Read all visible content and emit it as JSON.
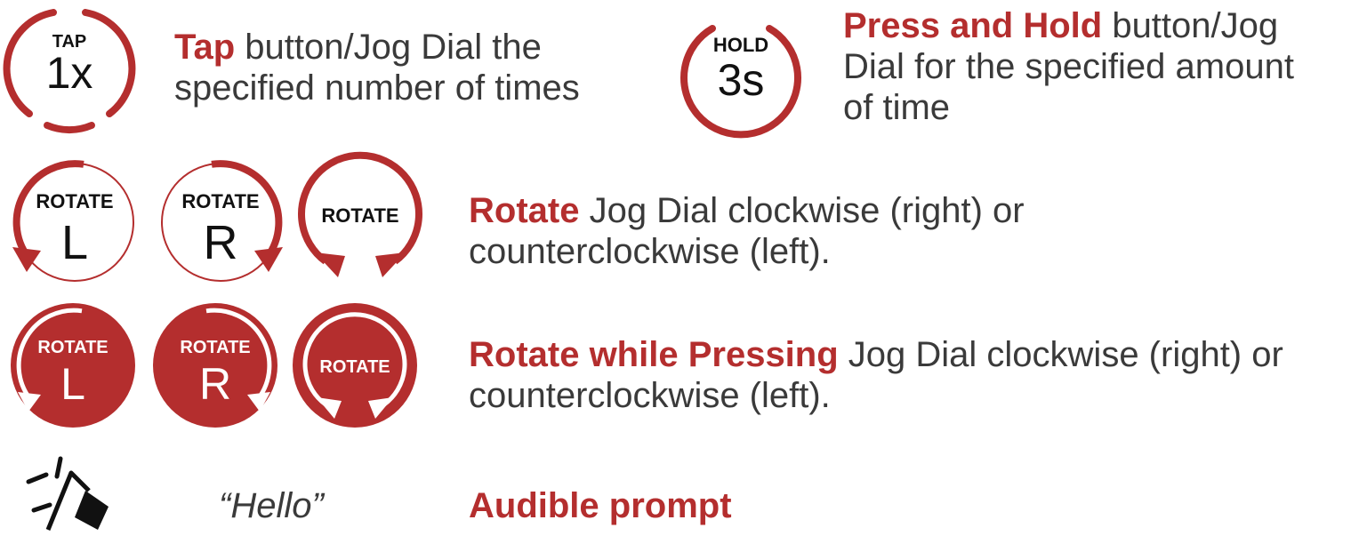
{
  "colors": {
    "accent": "#b42e2e",
    "text": "#3a3a3a",
    "background": "#ffffff"
  },
  "tap": {
    "icon": {
      "top": "TAP",
      "main": "1x"
    },
    "highlight": "Tap",
    "line1_rest": " button/Jog Dial the",
    "line2": "specified number of times"
  },
  "hold": {
    "icon": {
      "top": "HOLD",
      "main": "3s"
    },
    "highlight": "Press and Hold",
    "line1_rest": " button/Jog",
    "line2": "Dial for the specified amount",
    "line3": "of time"
  },
  "rotate": {
    "icons": {
      "left_top": "ROTATE",
      "left_main": "L",
      "right_top": "ROTATE",
      "right_main": "R",
      "either_label": "ROTATE"
    },
    "highlight": "Rotate",
    "line1_rest": " Jog Dial clockwise (right) or",
    "line2": "counterclockwise (left)."
  },
  "rotate_press": {
    "icons": {
      "left_top": "ROTATE",
      "left_main": "L",
      "right_top": "ROTATE",
      "right_main": "R",
      "either_label": "ROTATE"
    },
    "highlight": "Rotate while Pressing",
    "line1_rest": " Jog Dial clockwise (right) or",
    "line2": "counterclockwise (left)."
  },
  "prompt": {
    "icon": "speaker-icon",
    "example": "“Hello”",
    "label": "Audible prompt"
  }
}
